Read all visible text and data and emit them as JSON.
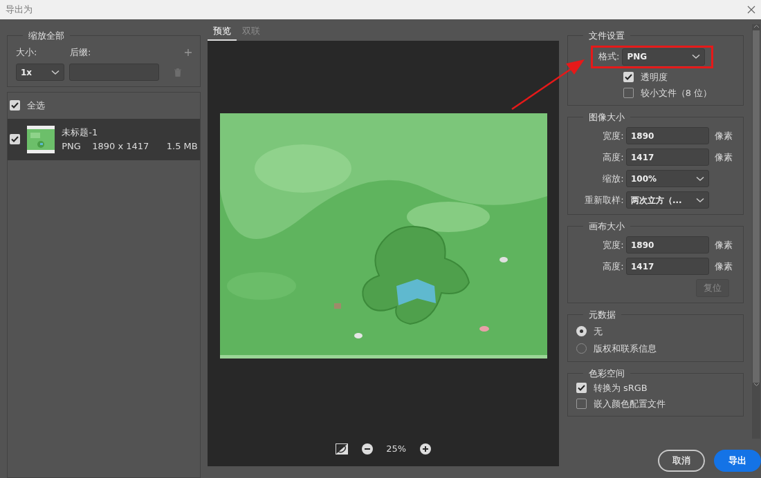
{
  "window": {
    "title": "导出为"
  },
  "scale_all": {
    "title": "缩放全部",
    "size_label": "大小:",
    "suffix_label": "后缀:",
    "size_value": "1x"
  },
  "select_all": {
    "label": "全选",
    "checked": true
  },
  "assets": [
    {
      "name": "未标题-1",
      "format": "PNG",
      "dimensions": "1890 x 1417",
      "file_size": "1.5 MB",
      "checked": true,
      "selected": true
    }
  ],
  "preview": {
    "tabs": [
      {
        "label": "预览",
        "selected": true
      },
      {
        "label": "双联",
        "selected": false
      }
    ],
    "zoom": "25%"
  },
  "file_settings": {
    "title": "文件设置",
    "format_label": "格式:",
    "format_value": "PNG",
    "highlighted": true,
    "options": [
      {
        "label": "透明度",
        "checked": true
      },
      {
        "label": "较小文件（8 位）",
        "checked": false
      }
    ]
  },
  "image_size": {
    "title": "图像大小",
    "rows": [
      {
        "kind": "input",
        "label": "宽度:",
        "value": "1890",
        "unit": "像素"
      },
      {
        "kind": "input",
        "label": "高度:",
        "value": "1417",
        "unit": "像素"
      },
      {
        "kind": "select",
        "label": "缩放:",
        "value": "100%"
      },
      {
        "kind": "select",
        "label": "重新取样:",
        "value": "两次立方（..."
      }
    ]
  },
  "canvas_size": {
    "title": "画布大小",
    "rows": [
      {
        "kind": "input",
        "label": "宽度:",
        "value": "1890",
        "unit": "像素"
      },
      {
        "kind": "input",
        "label": "高度:",
        "value": "1417",
        "unit": "像素"
      }
    ],
    "reset_button": {
      "label": "复位",
      "disabled": true
    }
  },
  "metadata": {
    "title": "元数据",
    "options": [
      {
        "label": "无",
        "selected": true
      },
      {
        "label": "版权和联系信息",
        "selected": false
      }
    ]
  },
  "color_space": {
    "title": "色彩空间",
    "options": [
      {
        "label": "转换为 sRGB",
        "checked": true
      },
      {
        "label": "嵌入颜色配置文件",
        "checked": false
      }
    ]
  },
  "buttons": [
    {
      "label": "取消",
      "kind": "secondary"
    },
    {
      "label": "导出",
      "kind": "primary"
    }
  ]
}
